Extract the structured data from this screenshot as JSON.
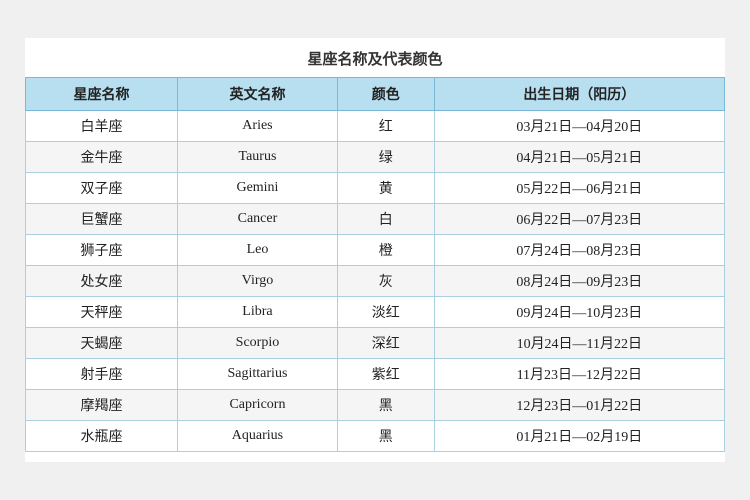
{
  "title": "星座名称及代表颜色",
  "headers": [
    "星座名称",
    "英文名称",
    "颜色",
    "出生日期（阳历）"
  ],
  "rows": [
    {
      "chinese": "白羊座",
      "english": "Aries",
      "color": "红",
      "date": "03月21日—04月20日"
    },
    {
      "chinese": "金牛座",
      "english": "Taurus",
      "color": "绿",
      "date": "04月21日—05月21日"
    },
    {
      "chinese": "双子座",
      "english": "Gemini",
      "color": "黄",
      "date": "05月22日—06月21日"
    },
    {
      "chinese": "巨蟹座",
      "english": "Cancer",
      "color": "白",
      "date": "06月22日—07月23日"
    },
    {
      "chinese": "狮子座",
      "english": "Leo",
      "color": "橙",
      "date": "07月24日—08月23日"
    },
    {
      "chinese": "处女座",
      "english": "Virgo",
      "color": "灰",
      "date": "08月24日—09月23日"
    },
    {
      "chinese": "天秤座",
      "english": "Libra",
      "color": "淡红",
      "date": "09月24日—10月23日"
    },
    {
      "chinese": "天蝎座",
      "english": "Scorpio",
      "color": "深红",
      "date": "10月24日—11月22日"
    },
    {
      "chinese": "射手座",
      "english": "Sagittarius",
      "color": "紫红",
      "date": "11月23日—12月22日"
    },
    {
      "chinese": "摩羯座",
      "english": "Capricorn",
      "color": "黑",
      "date": "12月23日—01月22日"
    },
    {
      "chinese": "水瓶座",
      "english": "Aquarius",
      "color": "黑",
      "date": "01月21日—02月19日"
    }
  ]
}
